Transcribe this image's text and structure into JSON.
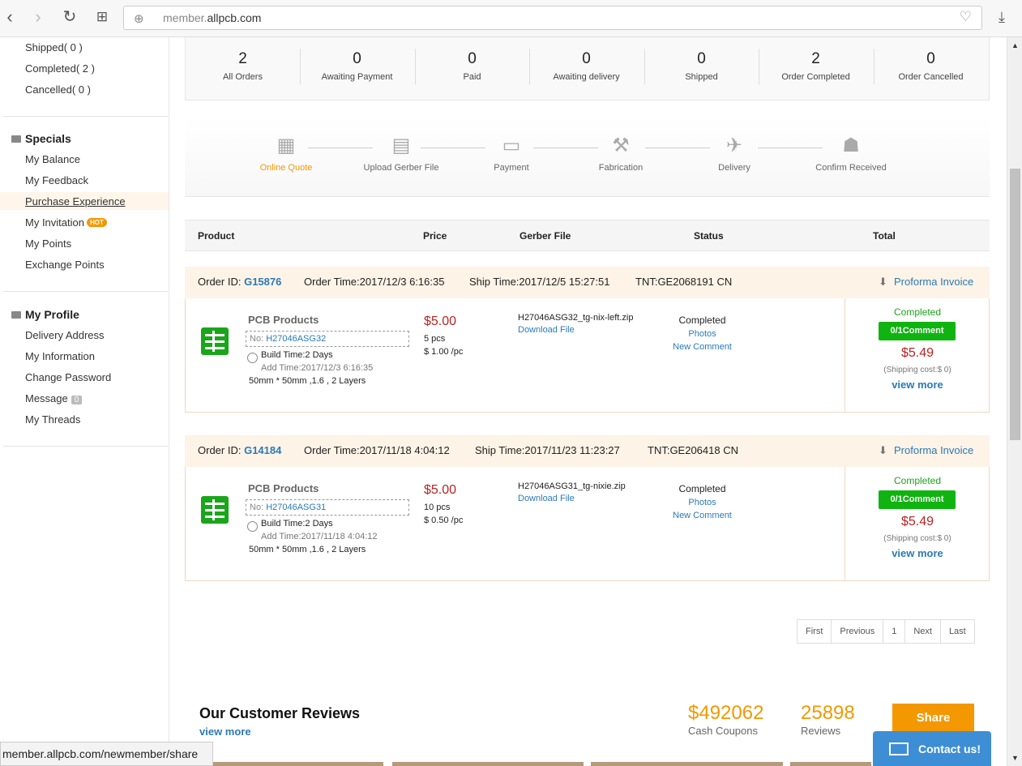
{
  "browser": {
    "url_prefix": "member.",
    "url_domain": "allpcb.com"
  },
  "sidebar": {
    "orders": [
      {
        "label": "Shipped( 0 )"
      },
      {
        "label": "Completed( 2 )"
      },
      {
        "label": "Cancelled( 0 )"
      }
    ],
    "specials_title": "Specials",
    "specials": [
      {
        "label": "My Balance"
      },
      {
        "label": "My Feedback"
      },
      {
        "label": "Purchase Experience"
      },
      {
        "label": "My Invitation",
        "badge": "HOT"
      },
      {
        "label": "My Points"
      },
      {
        "label": "Exchange Points"
      }
    ],
    "profile_title": "My Profile",
    "profile": [
      {
        "label": "Delivery Address"
      },
      {
        "label": "My Information"
      },
      {
        "label": "Change Password"
      },
      {
        "label": "Message",
        "badge": "0"
      },
      {
        "label": "My Threads"
      }
    ]
  },
  "stats": [
    {
      "num": "2",
      "label": "All Orders"
    },
    {
      "num": "0",
      "label": "Awaiting Payment"
    },
    {
      "num": "0",
      "label": "Paid"
    },
    {
      "num": "0",
      "label": "Awaiting delivery"
    },
    {
      "num": "0",
      "label": "Shipped"
    },
    {
      "num": "2",
      "label": "Order Completed"
    },
    {
      "num": "0",
      "label": "Order Cancelled"
    }
  ],
  "steps": [
    {
      "label": "Online Quote",
      "icon": "calculator-icon"
    },
    {
      "label": "Upload Gerber File",
      "icon": "upload-file-icon"
    },
    {
      "label": "Payment",
      "icon": "card-icon"
    },
    {
      "label": "Fabrication",
      "icon": "wrench-icon"
    },
    {
      "label": "Delivery",
      "icon": "plane-icon"
    },
    {
      "label": "Confirm Received",
      "icon": "handshake-icon"
    }
  ],
  "table_headers": {
    "product": "Product",
    "price": "Price",
    "gerber": "Gerber File",
    "status": "Status",
    "total": "Total"
  },
  "orders": [
    {
      "id_label": "Order ID:",
      "id": "G15876",
      "order_time": "Order Time:2017/12/3 6:16:35",
      "ship_time": "Ship Time:2017/12/5 15:27:51",
      "tnt": "TNT:GE2068191 CN",
      "invoice": "Proforma Invoice",
      "product_name": "PCB Products",
      "no_label": "No:",
      "no": "H27046ASG32",
      "build_time": "Build Time:2 Days",
      "add_time": "Add Time:2017/12/3 6:16:35",
      "spec": "50mm * 50mm ,1.6 , 2 Layers",
      "price": "$5.00",
      "qty": "5 pcs",
      "unit_price": "$ 1.00 /pc",
      "gerber_file": "H27046ASG32_tg-nix-left.zip",
      "download": "Download File",
      "status": "Completed",
      "photos": "Photos",
      "new_comment": "New Comment",
      "right_status": "Completed",
      "comment_btn": "0/1Comment",
      "total": "$5.49",
      "shipping": "(Shipping cost:$ 0)",
      "view_more": "view more"
    },
    {
      "id_label": "Order ID:",
      "id": "G14184",
      "order_time": "Order Time:2017/11/18 4:04:12",
      "ship_time": "Ship Time:2017/11/23 11:23:27",
      "tnt": "TNT:GE206418 CN",
      "invoice": "Proforma Invoice",
      "product_name": "PCB Products",
      "no_label": "No:",
      "no": "H27046ASG31",
      "build_time": "Build Time:2 Days",
      "add_time": "Add Time:2017/11/18 4:04:12",
      "spec": "50mm * 50mm ,1.6 , 2 Layers",
      "price": "$5.00",
      "qty": "10 pcs",
      "unit_price": "$ 0.50 /pc",
      "gerber_file": "H27046ASG31_tg-nixie.zip",
      "download": "Download File",
      "status": "Completed",
      "photos": "Photos",
      "new_comment": "New Comment",
      "right_status": "Completed",
      "comment_btn": "0/1Comment",
      "total": "$5.49",
      "shipping": "(Shipping cost:$ 0)",
      "view_more": "view more"
    }
  ],
  "pager": [
    "First",
    "Previous",
    "1",
    "Next",
    "Last"
  ],
  "reviews": {
    "title": "Our Customer Reviews",
    "view_more": "view more",
    "coupons": "$492062",
    "coupons_label": "Cash Coupons",
    "reviews": "25898",
    "reviews_label": "Reviews",
    "share": "Share"
  },
  "statusbar_url": "member.allpcb.com/newmember/share",
  "contact": "Contact us!"
}
